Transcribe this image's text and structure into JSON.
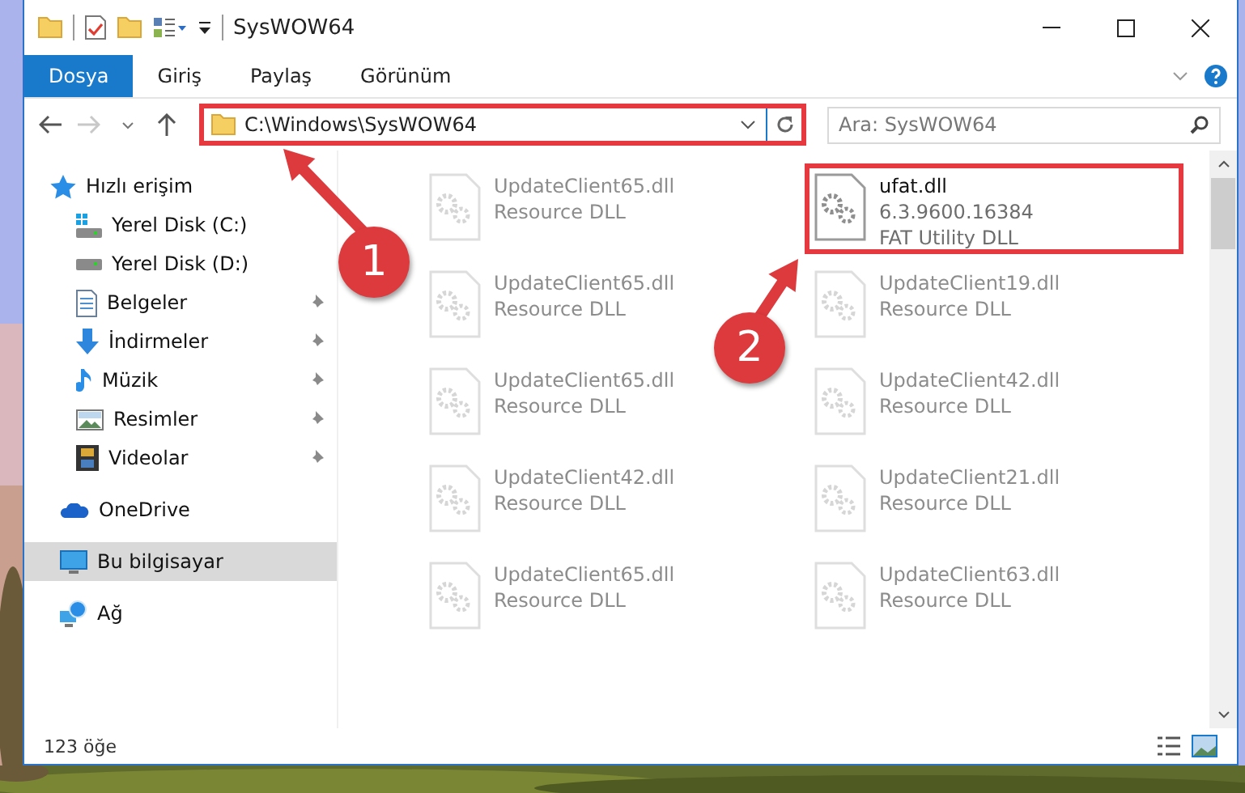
{
  "window": {
    "title": "SysWOW64"
  },
  "ribbon_tabs": [
    {
      "label": "Dosya",
      "selected": true
    },
    {
      "label": "Giriş",
      "selected": false
    },
    {
      "label": "Paylaş",
      "selected": false
    },
    {
      "label": "Görünüm",
      "selected": false
    }
  ],
  "address": {
    "path": "C:\\Windows\\SysWOW64",
    "highlighted": true
  },
  "search": {
    "placeholder": "Ara: SysWOW64"
  },
  "nav": [
    {
      "label": "Hızlı erişim",
      "kind": "star",
      "selected": false,
      "children": [
        {
          "label": "Yerel Disk (C:)",
          "kind": "systemdrive",
          "pinned": false,
          "selected": false
        },
        {
          "label": "Yerel Disk (D:)",
          "kind": "drive",
          "pinned": false,
          "selected": false
        },
        {
          "label": "Belgeler",
          "kind": "documents",
          "pinned": true,
          "selected": false
        },
        {
          "label": "İndirmeler",
          "kind": "downloads",
          "pinned": true,
          "selected": false
        },
        {
          "label": "Müzik",
          "kind": "music",
          "pinned": true,
          "selected": false
        },
        {
          "label": "Resimler",
          "kind": "pictures",
          "pinned": true,
          "selected": false
        },
        {
          "label": "Videolar",
          "kind": "videos",
          "pinned": true,
          "selected": false
        }
      ]
    },
    {
      "label": "OneDrive",
      "kind": "cloud",
      "selected": false
    },
    {
      "label": "Bu bilgisayar",
      "kind": "computer",
      "selected": true
    },
    {
      "label": "Ağ",
      "kind": "network",
      "selected": false
    }
  ],
  "files": [
    {
      "name": "UpdateClient65.dll",
      "lines": [
        "Resource DLL"
      ],
      "highlighted": false
    },
    {
      "name": "ufat.dll",
      "lines": [
        "6.3.9600.16384",
        "FAT Utility DLL"
      ],
      "highlighted": true
    },
    {
      "name": "UpdateClient65.dll",
      "lines": [
        "Resource DLL"
      ],
      "highlighted": false
    },
    {
      "name": "UpdateClient19.dll",
      "lines": [
        "Resource DLL"
      ],
      "highlighted": false
    },
    {
      "name": "UpdateClient65.dll",
      "lines": [
        "Resource DLL"
      ],
      "highlighted": false
    },
    {
      "name": "UpdateClient42.dll",
      "lines": [
        "Resource DLL"
      ],
      "highlighted": false
    },
    {
      "name": "UpdateClient42.dll",
      "lines": [
        "Resource DLL"
      ],
      "highlighted": false
    },
    {
      "name": "UpdateClient21.dll",
      "lines": [
        "Resource DLL"
      ],
      "highlighted": false
    },
    {
      "name": "UpdateClient65.dll",
      "lines": [
        "Resource DLL"
      ],
      "highlighted": false
    },
    {
      "name": "UpdateClient63.dll",
      "lines": [
        "Resource DLL"
      ],
      "highlighted": false
    }
  ],
  "status_bar": {
    "count": "123 öğe"
  },
  "annotations": [
    {
      "label": "1"
    },
    {
      "label": "2"
    }
  ]
}
